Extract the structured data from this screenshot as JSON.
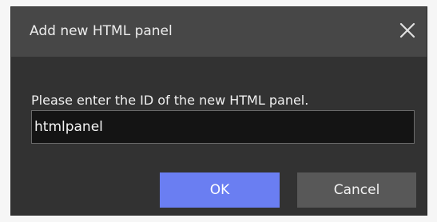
{
  "dialog": {
    "title": "Add new HTML panel",
    "close_icon": "close-icon",
    "prompt": "Please enter the ID of the new HTML panel.",
    "input_value": "htmlpanel",
    "ok_label": "OK",
    "cancel_label": "Cancel"
  },
  "colors": {
    "dialog_bg": "#323232",
    "titlebar_bg": "#474747",
    "ok_button": "#6a7ef2",
    "cancel_button": "#585858"
  }
}
